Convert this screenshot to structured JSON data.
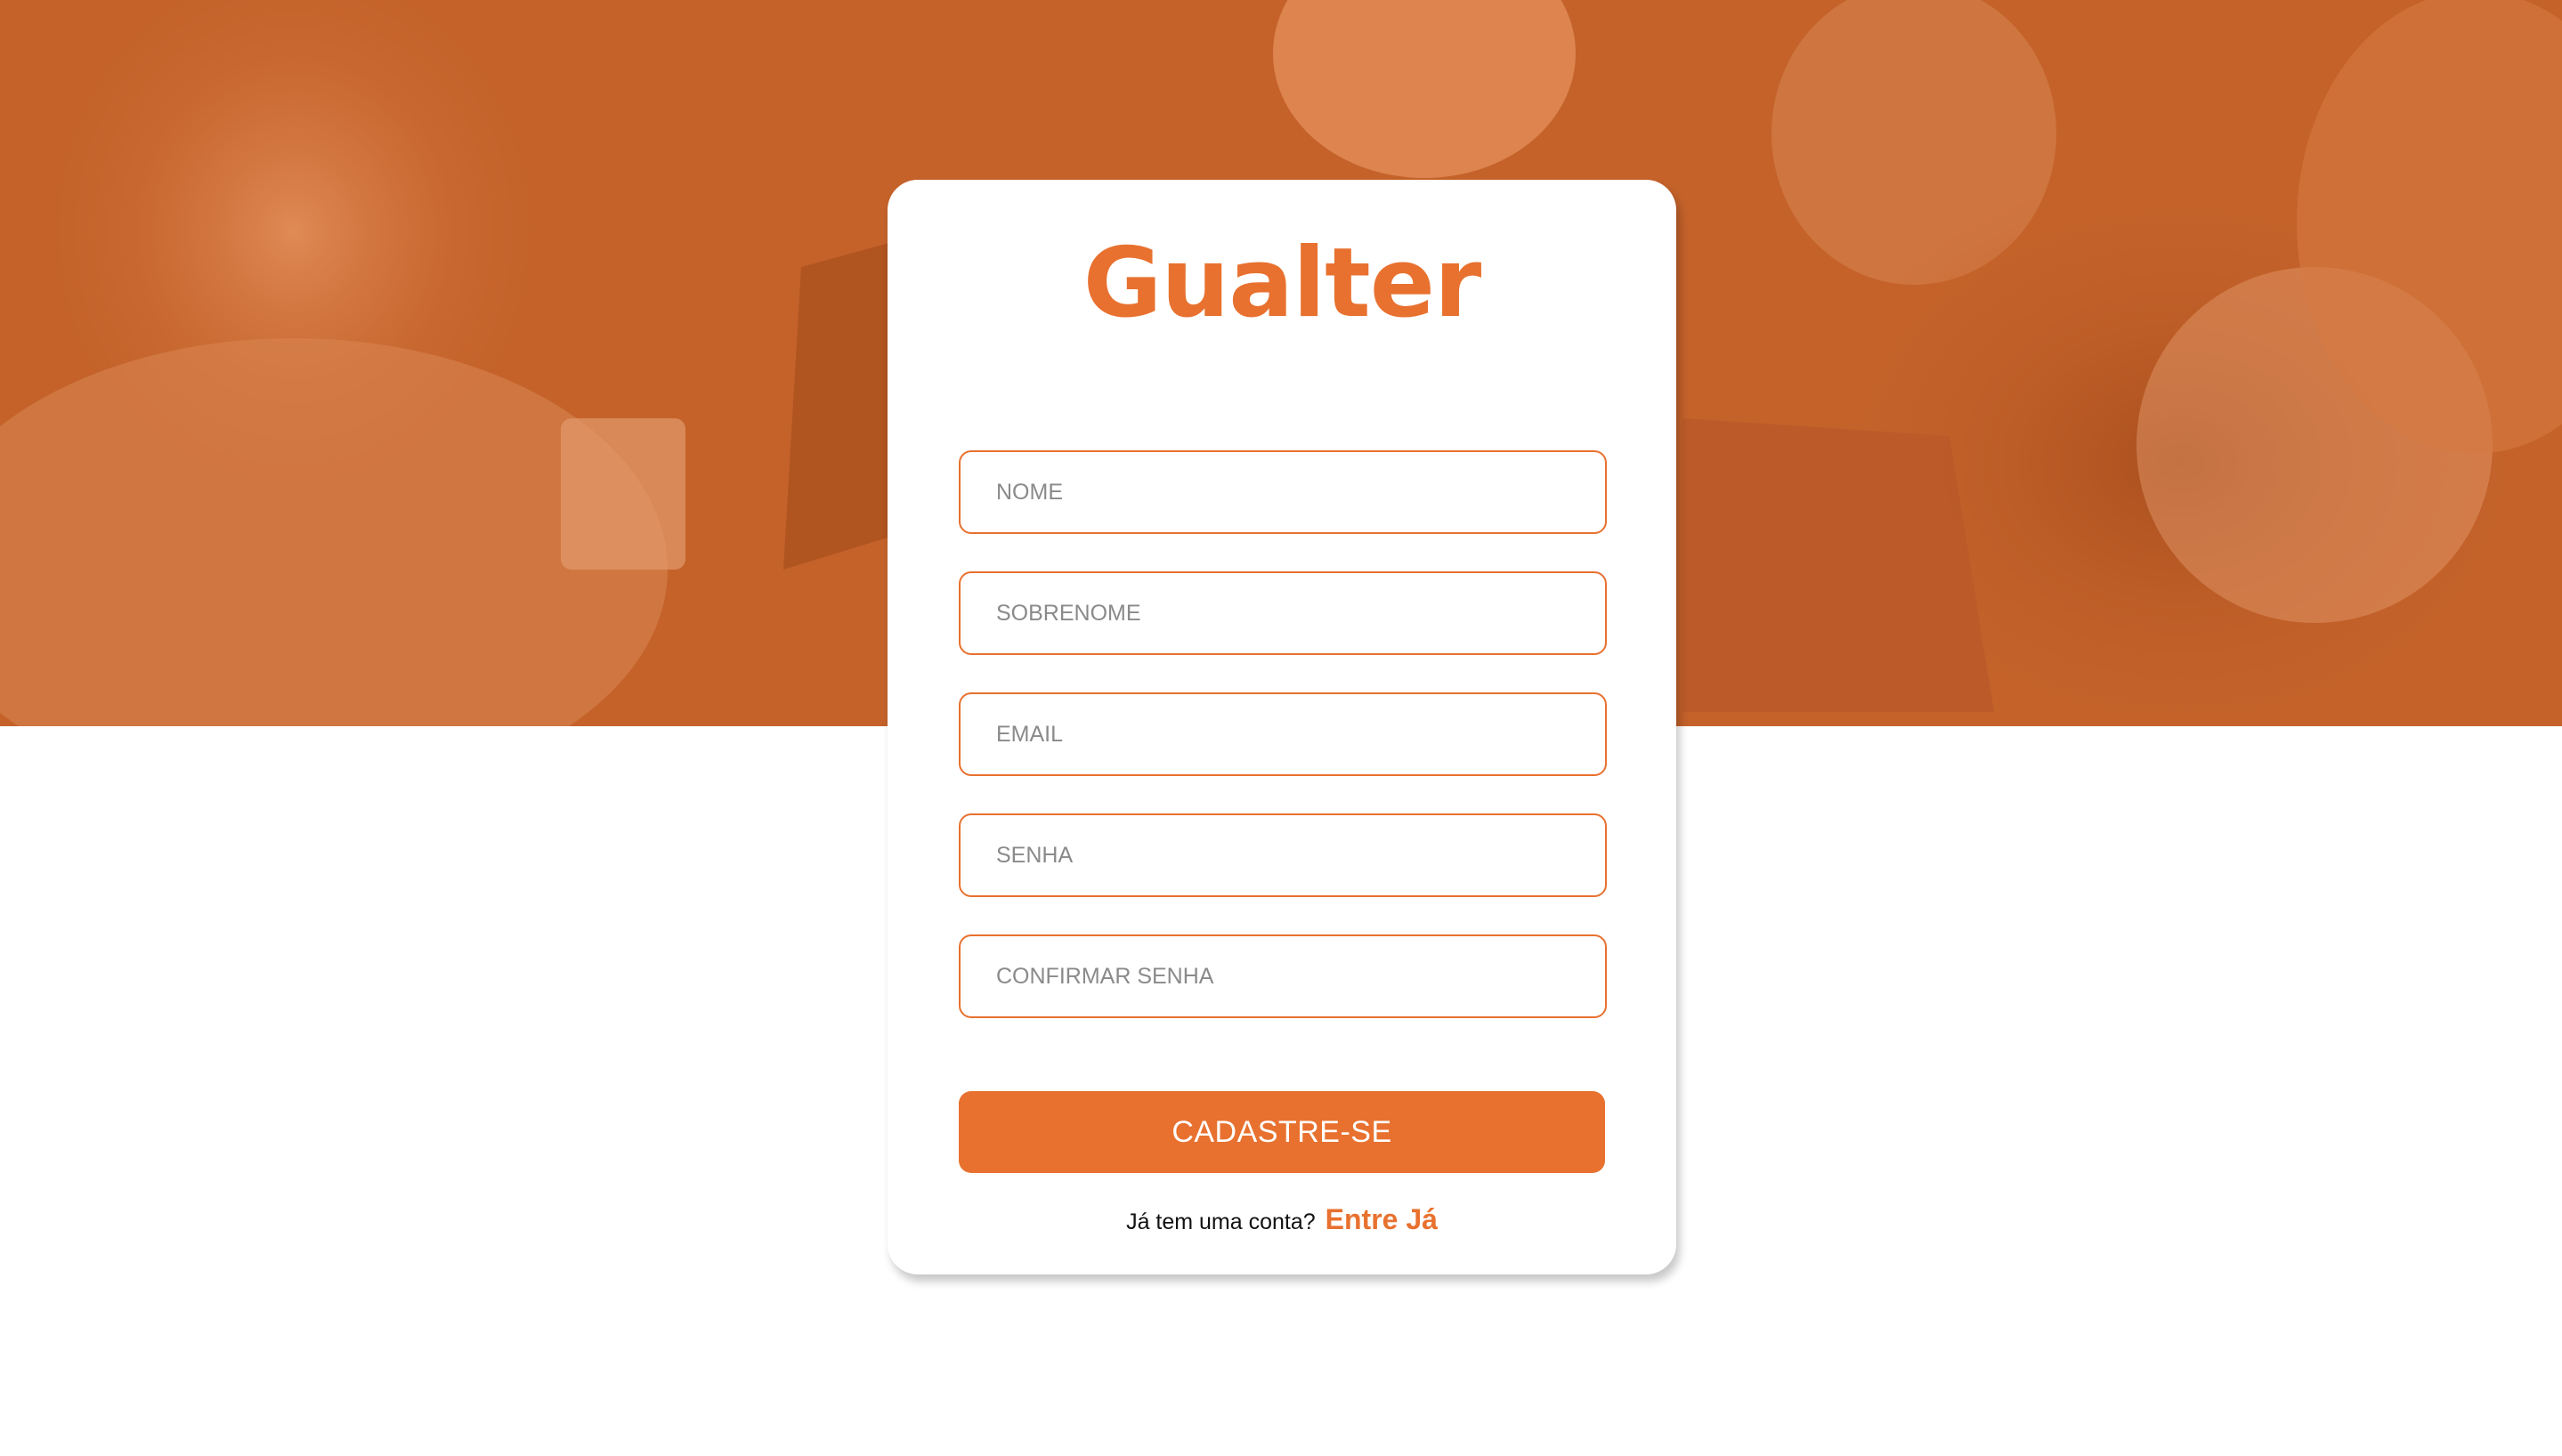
{
  "brand": {
    "name": "Gualter",
    "accent_color": "#e8712f",
    "hero_overlay_color": "#c4622a"
  },
  "form": {
    "fields": [
      {
        "placeholder": "NOME",
        "value": ""
      },
      {
        "placeholder": "SOBRENOME",
        "value": ""
      },
      {
        "placeholder": "EMAIL",
        "value": ""
      },
      {
        "placeholder": "SENHA",
        "value": ""
      },
      {
        "placeholder": "CONFIRMAR SENHA",
        "value": ""
      }
    ],
    "submit_label": "CADASTRE-SE"
  },
  "footer": {
    "prompt": "Já tem uma conta?",
    "link_label": "Entre Já"
  }
}
